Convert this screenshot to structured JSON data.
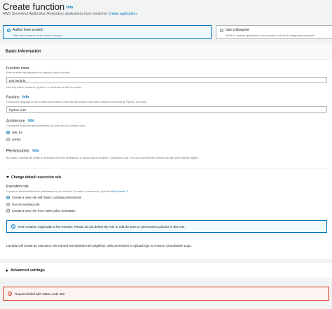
{
  "header": {
    "title": "Create function",
    "info": "Info",
    "notice_prefix": "AWS Serverless Application Repository applications have moved to",
    "notice_link": "Create application."
  },
  "options": [
    {
      "title": "Author from scratch",
      "desc": "Start with a simple Hello World example.",
      "selected": true
    },
    {
      "title": "Use a blueprint",
      "desc": "Build a Lambda application from sample code and configuration presets",
      "selected": false
    }
  ],
  "basic": {
    "heading": "Basic information",
    "function_name": {
      "label": "Function name",
      "hint": "Enter a name that describes the purpose of your function.",
      "value": "test lambda",
      "constraint": "Use only letters, numbers, hyphens, or underscores with no spaces."
    },
    "runtime": {
      "label": "Runtime",
      "info": "Info",
      "hint": "Choose the language to use to write your function. Note that the console code editor supports only Node.js, Python, and Ruby.",
      "value": "Python 3.10"
    },
    "architecture": {
      "label": "Architecture",
      "info": "Info",
      "hint": "Choose the instruction set architecture you want for your function code.",
      "options": [
        "x86_64",
        "arm64"
      ],
      "selected": "x86_64"
    },
    "permissions": {
      "label": "Permissions",
      "info": "Info",
      "hint": "By default, Lambda will create an execution role with permissions to upload logs to Amazon CloudWatch Logs. You can customize this default role later when adding triggers."
    }
  },
  "exec_role": {
    "toggle": "Change default execution role",
    "label": "Execution role",
    "hint_prefix": "Choose a role that defines the permissions of your function. To create a custom role, go to the",
    "hint_link": "IAM console",
    "options": [
      "Create a new role with basic Lambda permissions",
      "Use an existing role",
      "Create a new role from AWS policy templates"
    ],
    "selected": 0,
    "info_box": "Role creation might take a few minutes. Please do not delete the role or edit the trust or permissions policies in this role.",
    "footnote": "Lambda will create an execution role named test-lambda-role-phg8fv1s, with permission to upload logs to Amazon CloudWatch Logs."
  },
  "advanced": {
    "toggle": "Advanced settings"
  },
  "error": {
    "message": "Request failed with status code 403"
  },
  "colors": {
    "accent": "#0073bb",
    "error": "#d13212",
    "page_bg": "#f2f3f3"
  },
  "icons": [
    "info-icon",
    "error-icon",
    "external-link-icon",
    "caret-down-icon",
    "caret-right-icon"
  ]
}
